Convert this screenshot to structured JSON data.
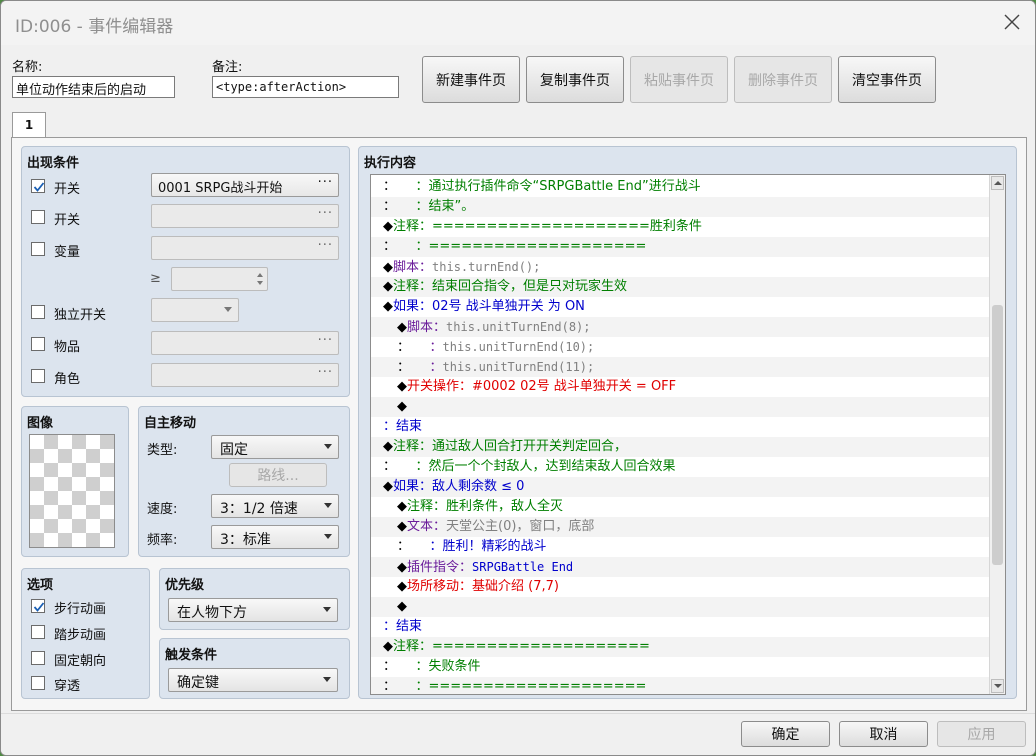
{
  "window": {
    "title": "ID:006 - 事件编辑器"
  },
  "colors": {
    "accent_blue": "#0000cc",
    "comment_green": "#007f00",
    "script_purple": "#6a1b9a",
    "switch_red": "#e00000",
    "gray_text": "#808080"
  },
  "header": {
    "name_label": "名称:",
    "name_value": "单位动作结束后的启动",
    "note_label": "备注:",
    "note_value": "<type:afterAction>"
  },
  "page_buttons": {
    "new": "新建事件页",
    "copy": "复制事件页",
    "paste": "粘贴事件页",
    "delete": "删除事件页",
    "clear": "清空事件页"
  },
  "tabs": [
    "1"
  ],
  "conditions": {
    "title": "出现条件",
    "switch1": {
      "label": "开关",
      "checked": true,
      "value": "0001 SRPG战斗开始"
    },
    "switch2": {
      "label": "开关",
      "checked": false,
      "value": ""
    },
    "variable": {
      "label": "变量",
      "checked": false,
      "value": "",
      "op": "≥",
      "num": ""
    },
    "self_switch": {
      "label": "独立开关",
      "checked": false,
      "value": ""
    },
    "item": {
      "label": "物品",
      "checked": false,
      "value": ""
    },
    "actor": {
      "label": "角色",
      "checked": false,
      "value": ""
    },
    "dots": "···"
  },
  "image": {
    "title": "图像"
  },
  "autonomous": {
    "title": "自主移动",
    "type_label": "类型:",
    "type_value": "固定",
    "route_button": "路线...",
    "speed_label": "速度:",
    "speed_value": "3：1/2 倍速",
    "freq_label": "频率:",
    "freq_value": "3：标准"
  },
  "options": {
    "title": "选项",
    "walking": {
      "label": "步行动画",
      "checked": true
    },
    "stepping": {
      "label": "踏步动画",
      "checked": false
    },
    "direction_fix": {
      "label": "固定朝向",
      "checked": false
    },
    "through": {
      "label": "穿透",
      "checked": false
    }
  },
  "priority": {
    "title": "优先级",
    "value": "在人物下方"
  },
  "trigger": {
    "title": "触发条件",
    "value": "确定键"
  },
  "contents": {
    "title": "执行内容",
    "lines": [
      {
        "indent": 0,
        "segs": [
          {
            "t": "：",
            "c": "#000"
          },
          {
            "t": "　　：通过执行插件命令“SRPGBattle End”进行战斗",
            "c": "#007f00"
          }
        ]
      },
      {
        "indent": 0,
        "segs": [
          {
            "t": "：",
            "c": "#000"
          },
          {
            "t": "　　：结束”。",
            "c": "#007f00"
          }
        ]
      },
      {
        "indent": 0,
        "segs": [
          {
            "t": "◆",
            "c": "#000"
          },
          {
            "t": "注释：====================胜利条件",
            "c": "#007f00"
          }
        ]
      },
      {
        "indent": 0,
        "segs": [
          {
            "t": "：",
            "c": "#000"
          },
          {
            "t": "　　：====================",
            "c": "#007f00"
          }
        ]
      },
      {
        "indent": 0,
        "segs": [
          {
            "t": "◆",
            "c": "#000"
          },
          {
            "t": "脚本：",
            "c": "#6a1b9a"
          },
          {
            "t": "this.turnEnd();",
            "c": "#808080",
            "mono": true
          }
        ]
      },
      {
        "indent": 0,
        "segs": [
          {
            "t": "◆",
            "c": "#000"
          },
          {
            "t": "注释：结束回合指令，但是只对玩家生效",
            "c": "#007f00"
          }
        ]
      },
      {
        "indent": 0,
        "segs": [
          {
            "t": "◆",
            "c": "#000"
          },
          {
            "t": "如果：02号 战斗单独开关 为 ON",
            "c": "#0000cc"
          }
        ]
      },
      {
        "indent": 1,
        "segs": [
          {
            "t": "◆",
            "c": "#000"
          },
          {
            "t": "脚本：",
            "c": "#6a1b9a"
          },
          {
            "t": "this.unitTurnEnd(8);",
            "c": "#808080",
            "mono": true
          }
        ]
      },
      {
        "indent": 1,
        "segs": [
          {
            "t": "：",
            "c": "#000"
          },
          {
            "t": "　　：",
            "c": "#6a1b9a"
          },
          {
            "t": "this.unitTurnEnd(10);",
            "c": "#808080",
            "mono": true
          }
        ]
      },
      {
        "indent": 1,
        "segs": [
          {
            "t": "：",
            "c": "#000"
          },
          {
            "t": "　　：",
            "c": "#6a1b9a"
          },
          {
            "t": "this.unitTurnEnd(11);",
            "c": "#808080",
            "mono": true
          }
        ]
      },
      {
        "indent": 1,
        "segs": [
          {
            "t": "◆",
            "c": "#000"
          },
          {
            "t": "开关操作：#0002 02号 战斗单独开关 = OFF",
            "c": "#e00000"
          }
        ]
      },
      {
        "indent": 1,
        "segs": [
          {
            "t": "◆",
            "c": "#000"
          }
        ]
      },
      {
        "indent": 0,
        "segs": [
          {
            "t": "：结束",
            "c": "#0000cc"
          }
        ]
      },
      {
        "indent": 0,
        "segs": [
          {
            "t": "◆",
            "c": "#000"
          },
          {
            "t": "注释：通过敌人回合打开开关判定回合，",
            "c": "#007f00"
          }
        ]
      },
      {
        "indent": 0,
        "segs": [
          {
            "t": "：",
            "c": "#000"
          },
          {
            "t": "　　：然后一个个封敌人，达到结束敌人回合效果",
            "c": "#007f00"
          }
        ]
      },
      {
        "indent": 0,
        "segs": [
          {
            "t": "◆",
            "c": "#000"
          },
          {
            "t": "如果：敌人剩余数 ≤ 0",
            "c": "#0000cc"
          }
        ]
      },
      {
        "indent": 1,
        "segs": [
          {
            "t": "◆",
            "c": "#000"
          },
          {
            "t": "注释：胜利条件，敌人全灭",
            "c": "#007f00"
          }
        ]
      },
      {
        "indent": 1,
        "segs": [
          {
            "t": "◆",
            "c": "#000"
          },
          {
            "t": "文本：",
            "c": "#6a1b9a"
          },
          {
            "t": "天堂公主(0)，窗口，底部",
            "c": "#808080"
          }
        ]
      },
      {
        "indent": 1,
        "segs": [
          {
            "t": "：",
            "c": "#000"
          },
          {
            "t": "　　：胜利！精彩的战斗",
            "c": "#0000cc"
          }
        ]
      },
      {
        "indent": 1,
        "segs": [
          {
            "t": "◆",
            "c": "#000"
          },
          {
            "t": "插件指令：",
            "c": "#6a1b9a"
          },
          {
            "t": "SRPGBattle End",
            "c": "#0000cc",
            "mono": true
          }
        ]
      },
      {
        "indent": 1,
        "segs": [
          {
            "t": "◆",
            "c": "#000"
          },
          {
            "t": "场所移动：基础介绍 (7,7)",
            "c": "#e00000"
          }
        ]
      },
      {
        "indent": 1,
        "segs": [
          {
            "t": "◆",
            "c": "#000"
          }
        ]
      },
      {
        "indent": 0,
        "segs": [
          {
            "t": "：结束",
            "c": "#0000cc"
          }
        ]
      },
      {
        "indent": 0,
        "segs": [
          {
            "t": "◆",
            "c": "#000"
          },
          {
            "t": "注释：====================",
            "c": "#007f00"
          }
        ]
      },
      {
        "indent": 0,
        "segs": [
          {
            "t": "：",
            "c": "#000"
          },
          {
            "t": "　　：失败条件",
            "c": "#007f00"
          }
        ]
      },
      {
        "indent": 0,
        "segs": [
          {
            "t": "：",
            "c": "#000"
          },
          {
            "t": "　　：====================",
            "c": "#007f00"
          }
        ]
      }
    ]
  },
  "footer": {
    "ok": "确定",
    "cancel": "取消",
    "apply": "应用"
  }
}
